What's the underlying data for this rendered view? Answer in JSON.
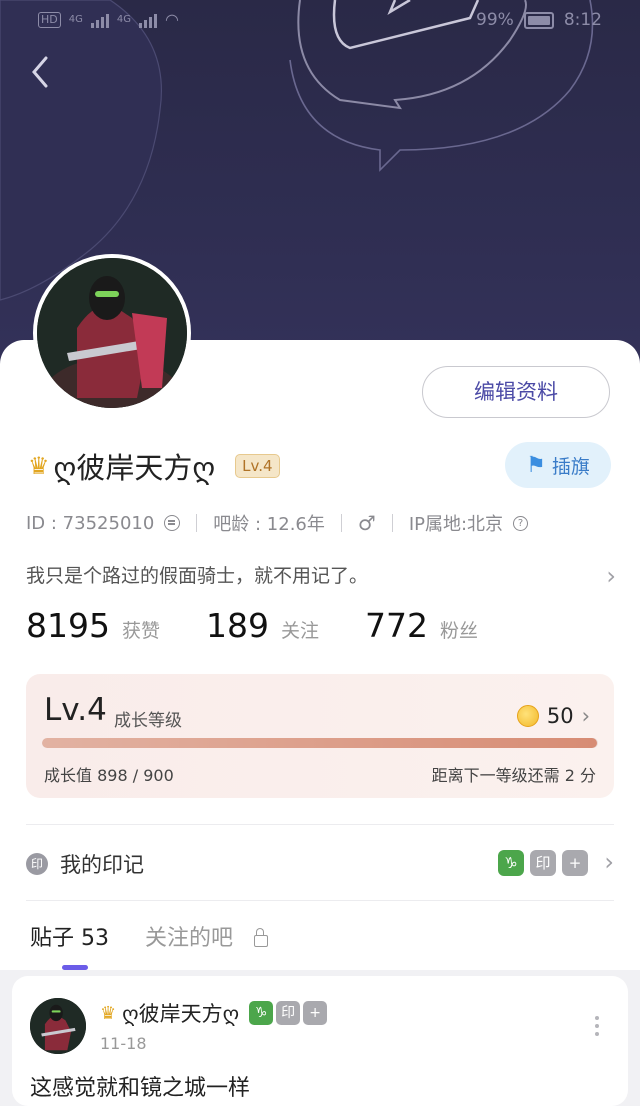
{
  "status_bar": {
    "hd": "HD",
    "network_1": "4G",
    "network_2": "4G",
    "battery_pct": "99%",
    "time": "8:12"
  },
  "header": {
    "back_icon": "chevron-left-icon"
  },
  "profile": {
    "edit_label": "编辑资料",
    "crown_icon": "crown-icon",
    "username": "ღ彼岸天方ღ",
    "level_badge": "Lv.4",
    "flag_label": "插旗",
    "id_text": "ID : 73525010",
    "age_text": "吧龄 : 12.6年",
    "gender_icon": "male-icon",
    "ip_text": "IP属地:北京",
    "bio": "我只是个路过的假面骑士，就不用记了。"
  },
  "stats": [
    {
      "value": "8195",
      "label": "获赞"
    },
    {
      "value": "189",
      "label": "关注"
    },
    {
      "value": "772",
      "label": "粉丝"
    }
  ],
  "level_card": {
    "level": "Lv.4",
    "level_label": "成长等级",
    "coins": "50",
    "progress": 0.998,
    "growth_label": "成长值",
    "growth_value": "898 / 900",
    "next_text": "距离下一等级还需 2 分"
  },
  "seals": {
    "icon_text": "印",
    "label": "我的印记",
    "badges": [
      "♑",
      "印",
      "+"
    ]
  },
  "tabs": [
    {
      "label": "贴子 53",
      "active": true
    },
    {
      "label": "关注的吧",
      "active": false
    }
  ],
  "post": {
    "name": "ღ彼岸天方ღ",
    "badges": [
      "♑",
      "印",
      "+"
    ],
    "date": "11-18",
    "text": "这感觉就和镜之城一样"
  },
  "colors": {
    "header_bg": "#2d2c4f",
    "accent": "#6b5ce8",
    "edit_text": "#4b4aa6"
  }
}
